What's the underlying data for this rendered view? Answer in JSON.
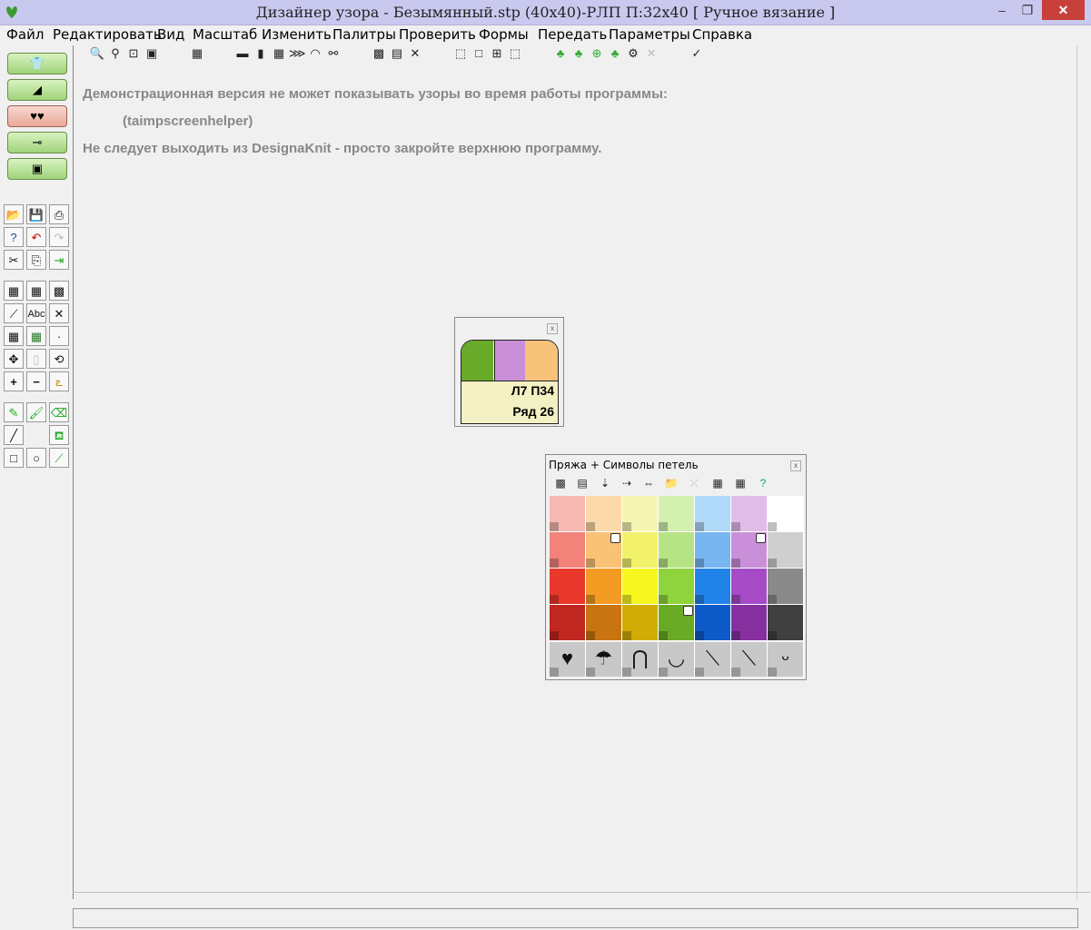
{
  "window": {
    "title": "Дизайнер узора - Безымянный.stp (40x40)-РЛП     П:32x40     [ Ручное вязание ]",
    "min": "–",
    "max": "❐",
    "close": "✕"
  },
  "menu": [
    "Файл",
    "Редактировать",
    "Вид",
    "Масштаб",
    "Изменить",
    "Палитры",
    "Проверить",
    "Формы",
    "Передать",
    "Параметры",
    "Справка"
  ],
  "messages": {
    "line1": "Демонстрационная версия не может показывать узоры во время работы программы:",
    "line2": "(taimpscreenhelper)",
    "line3": "Не следует выходить из DesignaKnit - просто закройте верхнюю программу."
  },
  "mini_window": {
    "swatches": [
      "#6aaa2a",
      "#c990d8",
      "#f7c27a"
    ],
    "position": "Л7 П34",
    "row": "Ряд 26",
    "close": "x"
  },
  "palette_window": {
    "title": "Пряжа + Символы петель",
    "close": "x",
    "colors": [
      [
        "#f7b9b2",
        "#fcd9a9",
        "#f5f5b2",
        "#d4f0b0",
        "#b0d8f8",
        "#e0bde8",
        "#ffffff"
      ],
      [
        "#f1837a",
        "#f9c274",
        "#f2f26a",
        "#b6e484",
        "#78b6f2",
        "#c98fd8",
        "#cfcfcf"
      ],
      [
        "#e9392d",
        "#f39b22",
        "#f7f720",
        "#8fd43c",
        "#2183ea",
        "#a54bc5",
        "#8a8a8a"
      ],
      [
        "#c0281f",
        "#c87411",
        "#d2ac06",
        "#6aab25",
        "#0d5ac8",
        "#86309f",
        "#404040"
      ]
    ],
    "symbols": [
      "♥",
      "☂",
      "⋂",
      "◡",
      "⟍",
      "⟍",
      "ᵕ"
    ]
  }
}
